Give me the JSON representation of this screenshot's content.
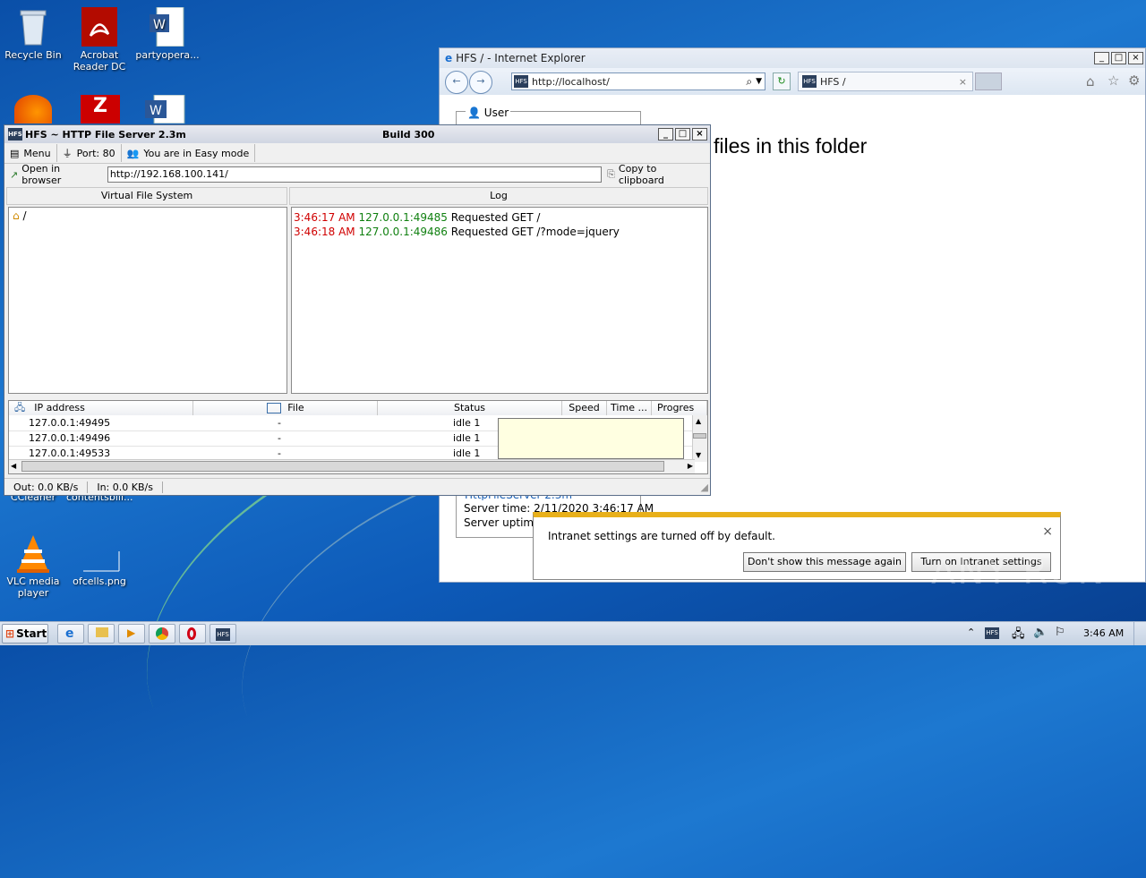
{
  "desktop": {
    "icons": [
      {
        "label": "Recycle Bin",
        "name": "recycle-bin-icon"
      },
      {
        "label": "Acrobat Reader DC",
        "name": "acrobat-icon"
      },
      {
        "label": "partyopera...",
        "name": "word-doc-icon"
      },
      {
        "label": "VLC media player",
        "name": "vlc-icon"
      },
      {
        "label": "ofcells.png",
        "name": "image-file-icon"
      },
      {
        "label": "CCleaner",
        "name": "ccleaner-icon"
      },
      {
        "label": "contentsbill...",
        "name": "doc-file-icon"
      }
    ]
  },
  "ie": {
    "title": "HFS / - Internet Explorer",
    "address": "http://localhost/",
    "tab_label": "HFS /",
    "user_label": "User",
    "heading": "files in this folder",
    "server_link": "HttpFileServer 2.3m",
    "server_time": "Server time: 2/11/2020 3:46:17 AM",
    "server_uptime": "Server uptime:",
    "notification": {
      "text": "Intranet settings are turned off by default.",
      "btn_dont_show": "Don't show this message again",
      "btn_turn_on": "Turn on Intranet settings"
    }
  },
  "hfs": {
    "title": "HFS ~ HTTP File Server 2.3m",
    "build": "Build 300",
    "menu": "Menu",
    "port": "Port: 80",
    "mode": "You are in Easy mode",
    "open_in_browser": "Open in browser",
    "url": "http://192.168.100.141/",
    "copy_clipboard": "Copy to clipboard",
    "vfs_header": "Virtual File System",
    "vfs_root": "/",
    "log_header": "Log",
    "log": [
      {
        "time": "3:46:17 AM",
        "addr": "127.0.0.1:49485",
        "msg": "Requested GET /"
      },
      {
        "time": "3:46:18 AM",
        "addr": "127.0.0.1:49486",
        "msg": "Requested GET /?mode=jquery"
      }
    ],
    "columns": [
      "IP address",
      "File",
      "Status",
      "Speed",
      "Time ...",
      "Progres"
    ],
    "connections": [
      {
        "ip": "127.0.0.1:49495",
        "file": "-",
        "status": "idle 1"
      },
      {
        "ip": "127.0.0.1:49496",
        "file": "-",
        "status": "idle 1"
      },
      {
        "ip": "127.0.0.1:49533",
        "file": "-",
        "status": "idle 1"
      }
    ],
    "out": "Out: 0.0 KB/s",
    "in": "In: 0.0 KB/s"
  },
  "taskbar": {
    "start": "Start",
    "time": "3:46 AM"
  },
  "watermark": "ANY RUN"
}
